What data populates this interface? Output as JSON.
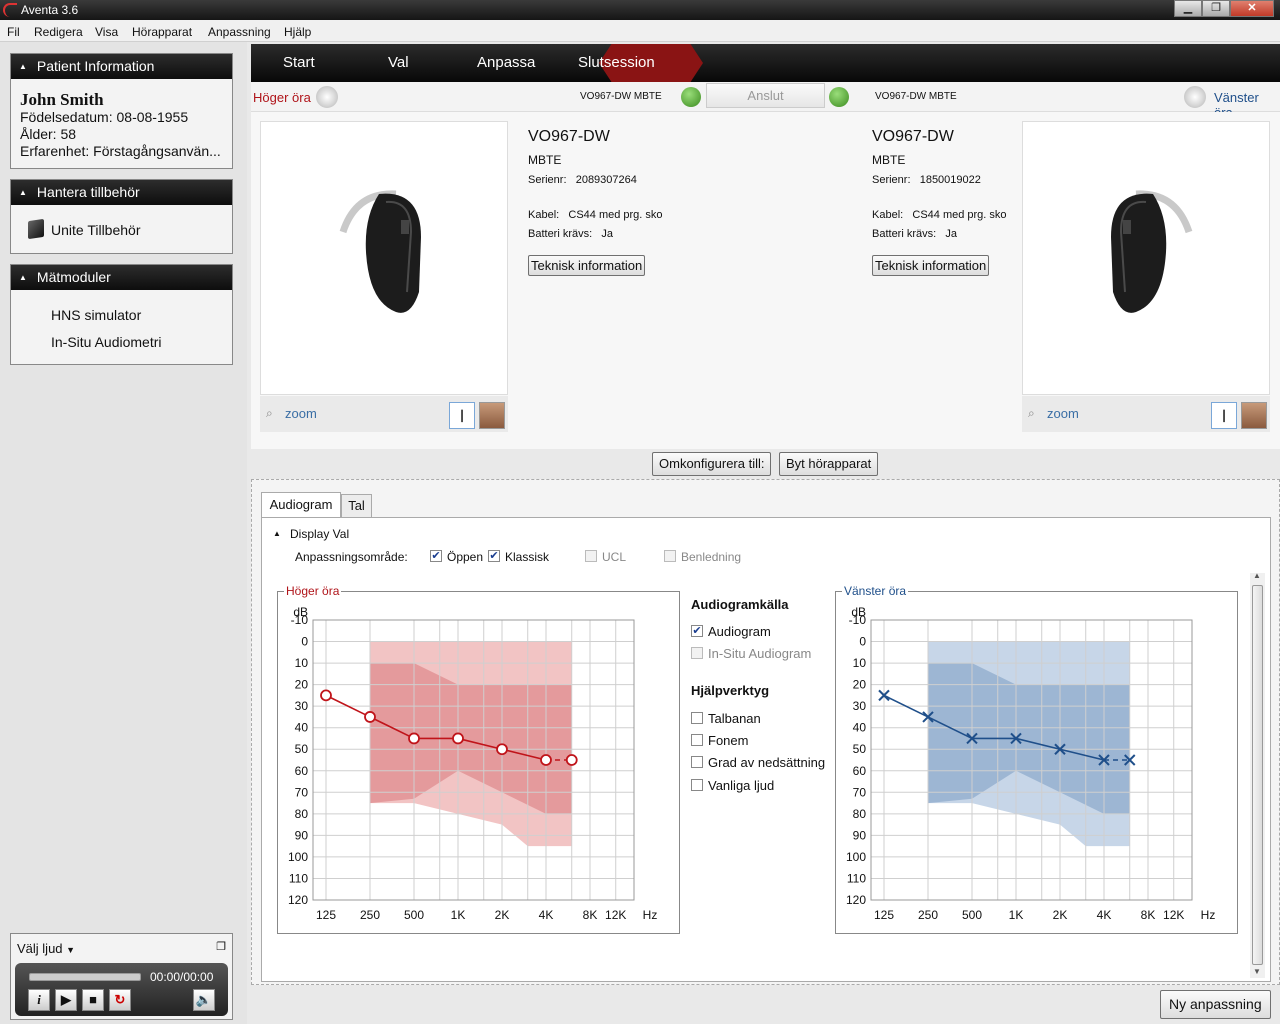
{
  "window": {
    "title": "Aventa 3.6",
    "min": "▁",
    "max": "❐",
    "close": "✕"
  },
  "menu": [
    "Fil",
    "Redigera",
    "Visa",
    "Hörapparat",
    "Anpassning",
    "Hjälp"
  ],
  "patient": {
    "header": "Patient Information",
    "name": "John Smith",
    "dob": "Födelsedatum: 08-08-1955",
    "age": "Ålder: 58",
    "experience": "Erfarenhet: Förstagångsanvän..."
  },
  "accessories": {
    "header": "Hantera tillbehör",
    "item": "Unite Tillbehör"
  },
  "modules": {
    "header": "Mätmoduler",
    "items": [
      "HNS simulator",
      "In-Situ Audiometri"
    ]
  },
  "player": {
    "label": "Välj ljud",
    "time": "00:00/00:00"
  },
  "tabs": [
    "Start",
    "Val",
    "Anpassa",
    "Slutsession"
  ],
  "active_tab": "Val",
  "connect": {
    "right_label": "Höger öra",
    "left_label": "Vänster öra",
    "right_model": "VO967-DW MBTE",
    "left_model": "VO967-DW MBTE",
    "button": "Anslut"
  },
  "devices": [
    {
      "model": "VO967-DW",
      "type": "MBTE",
      "serial_label": "Serienr:",
      "serial": "2089307264",
      "cable_label": "Kabel:",
      "cable": "CS44 med prg. sko",
      "battery_label": "Batteri krävs:",
      "battery": "Ja",
      "tech_button": "Teknisk information",
      "zoom": "zoom"
    },
    {
      "model": "VO967-DW",
      "type": "MBTE",
      "serial_label": "Serienr:",
      "serial": "1850019022",
      "cable_label": "Kabel:",
      "cable": "CS44 med prg. sko",
      "battery_label": "Batteri krävs:",
      "battery": "Ja",
      "tech_button": "Teknisk information",
      "zoom": "zoom"
    }
  ],
  "actions": {
    "reconfigure": "Omkonfigurera till:",
    "swap": "Byt hörapparat",
    "new_fitting": "Ny anpassning"
  },
  "bottom_tabs": [
    "Audiogram",
    "Tal"
  ],
  "display": {
    "title": "Display Val",
    "range_label": "Anpassningsområde:",
    "options": [
      {
        "label": "Öppen",
        "checked": true,
        "enabled": true
      },
      {
        "label": "Klassisk",
        "checked": true,
        "enabled": true
      },
      {
        "label": "UCL",
        "checked": false,
        "enabled": false
      },
      {
        "label": "Benledning",
        "checked": false,
        "enabled": false
      }
    ]
  },
  "source": {
    "title": "Audiogramkälla",
    "options": [
      {
        "label": "Audiogram",
        "checked": true,
        "enabled": true
      },
      {
        "label": "In-Situ Audiogram",
        "checked": false,
        "enabled": false
      }
    ]
  },
  "tools": {
    "title": "Hjälpverktyg",
    "options": [
      {
        "label": "Talbanan",
        "checked": false
      },
      {
        "label": "Fonem",
        "checked": false
      },
      {
        "label": "Grad av nedsättning",
        "checked": false
      },
      {
        "label": "Vanliga ljud",
        "checked": false
      }
    ]
  },
  "chart_data": [
    {
      "type": "line",
      "title": "Höger öra",
      "ylabel": "dB",
      "xlabel": "Hz",
      "x_ticks": [
        "125",
        "250",
        "500",
        "1K",
        "2K",
        "4K",
        "8K",
        "12K"
      ],
      "y_ticks": [
        "-10",
        "0",
        "10",
        "20",
        "30",
        "40",
        "50",
        "60",
        "70",
        "80",
        "90",
        "100",
        "110",
        "120"
      ],
      "ylim": [
        -10,
        120
      ],
      "y_inverted": true,
      "x": [
        125,
        250,
        500,
        1000,
        2000,
        4000,
        6000
      ],
      "series": [
        {
          "values": [
            25,
            35,
            45,
            45,
            50,
            55,
            55
          ]
        }
      ],
      "marker": "circle",
      "color": "#c0141a",
      "fit_range_outer": {
        "x": [
          250,
          500,
          1000,
          2000,
          3000,
          4000,
          6000
        ],
        "upper": [
          0,
          0,
          0,
          0,
          0,
          0,
          0
        ],
        "lower": [
          75,
          75,
          80,
          85,
          95,
          95,
          95
        ]
      },
      "fit_range_inner": {
        "x": [
          250,
          500,
          1000,
          2000,
          4000,
          6000
        ],
        "upper": [
          10,
          10,
          20,
          20,
          20,
          20
        ],
        "lower": [
          75,
          73,
          60,
          70,
          80,
          80
        ]
      }
    },
    {
      "type": "line",
      "title": "Vänster öra",
      "ylabel": "dB",
      "xlabel": "Hz",
      "x_ticks": [
        "125",
        "250",
        "500",
        "1K",
        "2K",
        "4K",
        "8K",
        "12K"
      ],
      "y_ticks": [
        "-10",
        "0",
        "10",
        "20",
        "30",
        "40",
        "50",
        "60",
        "70",
        "80",
        "90",
        "100",
        "110",
        "120"
      ],
      "ylim": [
        -10,
        120
      ],
      "y_inverted": true,
      "x": [
        125,
        250,
        500,
        1000,
        2000,
        4000,
        6000
      ],
      "series": [
        {
          "values": [
            25,
            35,
            45,
            45,
            50,
            55,
            55
          ]
        }
      ],
      "marker": "cross",
      "color": "#1f4f8a",
      "fit_range_outer": {
        "x": [
          250,
          500,
          1000,
          2000,
          3000,
          4000,
          6000
        ],
        "upper": [
          0,
          0,
          0,
          0,
          0,
          0,
          0
        ],
        "lower": [
          75,
          75,
          80,
          85,
          95,
          95,
          95
        ]
      },
      "fit_range_inner": {
        "x": [
          250,
          500,
          1000,
          2000,
          4000,
          6000
        ],
        "upper": [
          10,
          10,
          20,
          20,
          20,
          20
        ],
        "lower": [
          75,
          73,
          60,
          70,
          80,
          80
        ]
      }
    }
  ]
}
